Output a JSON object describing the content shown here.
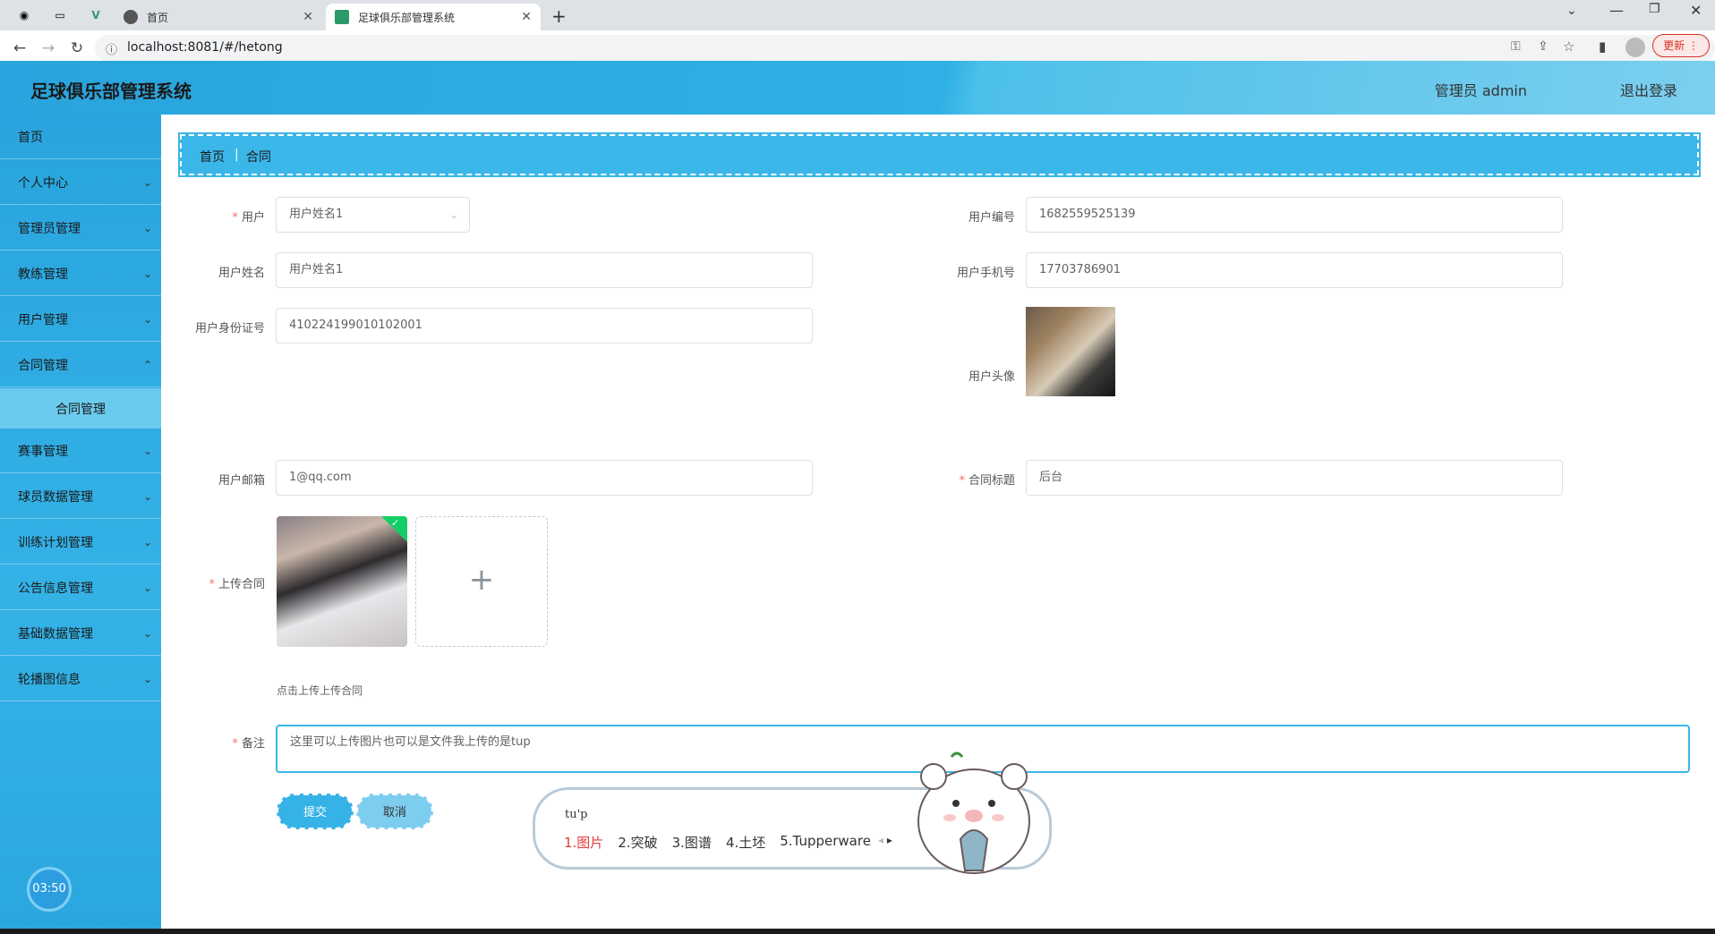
{
  "browser": {
    "tabs": [
      {
        "label": "首页"
      },
      {
        "label": "足球俱乐部管理系统"
      }
    ],
    "url": "localhost:8081/#/hetong",
    "update_label": "更新"
  },
  "header": {
    "title": "足球俱乐部管理系统",
    "user": "管理员 admin",
    "logout": "退出登录"
  },
  "sidebar": {
    "items": [
      {
        "label": "首页"
      },
      {
        "label": "个人中心"
      },
      {
        "label": "管理员管理"
      },
      {
        "label": "教练管理"
      },
      {
        "label": "用户管理"
      },
      {
        "label": "合同管理"
      },
      {
        "label": "赛事管理"
      },
      {
        "label": "球员数据管理"
      },
      {
        "label": "训练计划管理"
      },
      {
        "label": "公告信息管理"
      },
      {
        "label": "基础数据管理"
      },
      {
        "label": "轮播图信息"
      }
    ],
    "sub_item": "合同管理",
    "timer": "03:50"
  },
  "breadcrumb": {
    "home": "首页",
    "current": "合同"
  },
  "form": {
    "user_label": "用户",
    "user_value": "用户姓名1",
    "user_no_label": "用户编号",
    "user_no_value": "1682559525139",
    "name_label": "用户姓名",
    "name_value": "用户姓名1",
    "phone_label": "用户手机号",
    "phone_value": "17703786901",
    "id_label": "用户身份证号",
    "id_value": "410224199010102001",
    "avatar_label": "用户头像",
    "email_label": "用户邮箱",
    "email_value": "1@qq.com",
    "contract_title_label": "合同标题",
    "contract_title_value": "后台",
    "upload_label": "上传合同",
    "upload_tip": "点击上传上传合同",
    "remark_label": "备注",
    "remark_value": "这里可以上传图片也可以是文件我上传的是tup",
    "submit": "提交",
    "cancel": "取消"
  },
  "ime": {
    "input": "tu'p",
    "candidates": [
      "1.图片",
      "2.突破",
      "3.图谱",
      "4.土坯",
      "5.Tupperware"
    ]
  }
}
